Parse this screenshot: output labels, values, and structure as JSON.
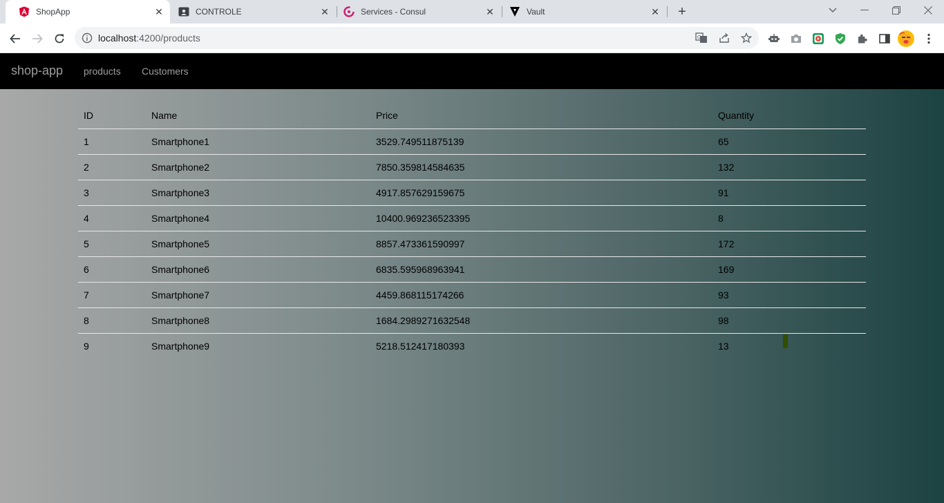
{
  "browser": {
    "tabs": [
      {
        "title": "ShopApp",
        "active": true,
        "icon": "angular-icon"
      },
      {
        "title": "CONTROLE",
        "active": false,
        "icon": "contact-card-icon"
      },
      {
        "title": "Services - Consul",
        "active": false,
        "icon": "consul-icon"
      },
      {
        "title": "Vault",
        "active": false,
        "icon": "vault-icon"
      }
    ],
    "url_host": "localhost",
    "url_path": ":4200/products"
  },
  "app": {
    "brand": "shop-app",
    "nav": [
      {
        "label": "products"
      },
      {
        "label": "Customers"
      }
    ]
  },
  "products": {
    "headers": {
      "id": "ID",
      "name": "Name",
      "price": "Price",
      "quantity": "Quantity"
    },
    "rows": [
      {
        "id": "1",
        "name": "Smartphone1",
        "price": "3529.749511875139",
        "quantity": "65"
      },
      {
        "id": "2",
        "name": "Smartphone2",
        "price": "7850.359814584635",
        "quantity": "132"
      },
      {
        "id": "3",
        "name": "Smartphone3",
        "price": "4917.857629159675",
        "quantity": "91"
      },
      {
        "id": "4",
        "name": "Smartphone4",
        "price": "10400.969236523395",
        "quantity": "8"
      },
      {
        "id": "5",
        "name": "Smartphone5",
        "price": "8857.473361590997",
        "quantity": "172"
      },
      {
        "id": "6",
        "name": "Smartphone6",
        "price": "6835.595968963941",
        "quantity": "169"
      },
      {
        "id": "7",
        "name": "Smartphone7",
        "price": "4459.868115174266",
        "quantity": "93"
      },
      {
        "id": "8",
        "name": "Smartphone8",
        "price": "1684.2989271632548",
        "quantity": "98"
      },
      {
        "id": "9",
        "name": "Smartphone9",
        "price": "5218.512417180393",
        "quantity": "13"
      }
    ]
  }
}
